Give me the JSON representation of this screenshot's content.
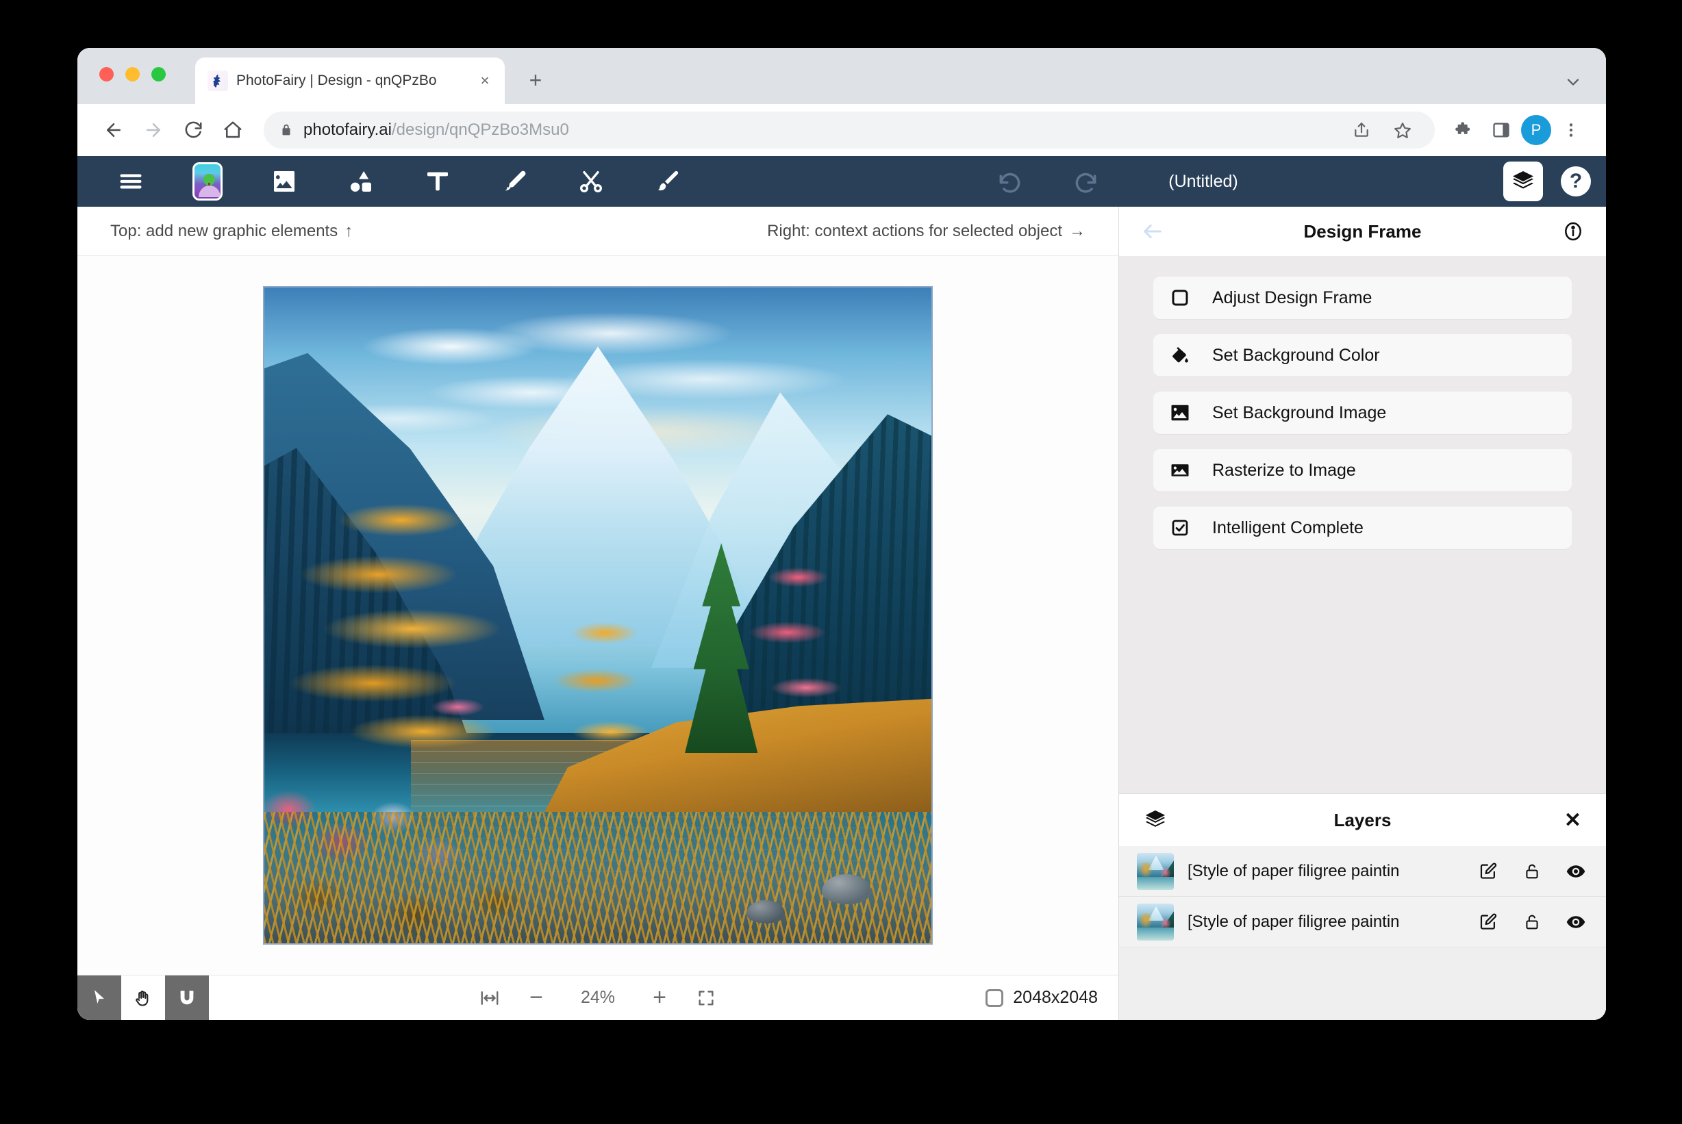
{
  "browser": {
    "tab": {
      "title": "PhotoFairy | Design - qnQPzBo",
      "favicon": "fairy-icon",
      "close": "×"
    },
    "new_tab_label": "+",
    "nav": {
      "back": "back-arrow-icon",
      "forward": "forward-arrow-icon",
      "reload": "reload-icon",
      "home": "home-icon"
    },
    "omnibox": {
      "lock": "lock-icon",
      "domain": "photofairy.ai",
      "path": "/design/qnQPzBo3Msu0",
      "share": "share-icon",
      "bookmark": "star-icon"
    },
    "toolbar": {
      "extensions": "puzzle-icon",
      "side_panel": "side-panel-icon",
      "avatar_letter": "P",
      "menu": "three-dot-menu-icon"
    }
  },
  "app": {
    "toolbar": {
      "menu": "hamburger-menu-icon",
      "thumbnail": "design-thumbnail-icon",
      "image": "image-icon",
      "shapes": "shapes-icon",
      "text": "T",
      "pen": "pen-icon",
      "cut": "scissors-icon",
      "brush": "paintbrush-icon",
      "undo": "undo-icon",
      "redo": "redo-icon",
      "title": "(Untitled)",
      "layers_toggle": "layers-icon",
      "help": "?"
    },
    "hints": {
      "left": "Top: add new graphic elements",
      "left_arrow": "↑",
      "right": "Right: context actions for selected object",
      "right_arrow": "→"
    },
    "statusbar": {
      "select_tool": "cursor-icon",
      "pan_tool": "hand-icon",
      "snap_tool": "magnet-icon",
      "fit_width": "fit-width-icon",
      "zoom_out": "−",
      "zoom_value": "24%",
      "zoom_in": "+",
      "fit_screen": "fit-screen-icon",
      "canvas_size": "2048x2048"
    }
  },
  "panel": {
    "header": {
      "back": "back-arrow-icon",
      "title": "Design Frame",
      "info": "info-icon"
    },
    "actions": [
      {
        "icon": "square-outline-icon",
        "label": "Adjust Design Frame"
      },
      {
        "icon": "paint-bucket-icon",
        "label": "Set Background Color"
      },
      {
        "icon": "image-filled-icon",
        "label": "Set Background Image"
      },
      {
        "icon": "rasterize-image-icon",
        "label": "Rasterize to Image"
      },
      {
        "icon": "checkbox-checked-icon",
        "label": "Intelligent Complete"
      }
    ],
    "layers": {
      "icon": "layers-stack-icon",
      "title": "Layers",
      "close": "✕",
      "rows": [
        {
          "name": "[Style of paper filigree paintin",
          "edit": "edit-icon",
          "lock": "unlock-icon",
          "visibility": "eye-icon"
        },
        {
          "name": "[Style of paper filigree paintin",
          "edit": "edit-icon",
          "lock": "unlock-icon",
          "visibility": "eye-icon"
        }
      ]
    }
  },
  "colors": {
    "app_toolbar": "#2a4058",
    "avatar": "#1a9bda",
    "panel_bg": "#eceaea",
    "action_bg": "#f8f8f8"
  }
}
